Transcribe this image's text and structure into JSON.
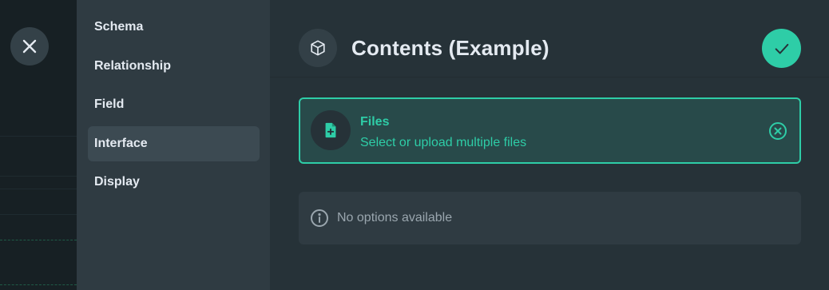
{
  "drawer": {
    "close_icon": "close-icon"
  },
  "sidebar": {
    "items": [
      {
        "label": "Schema",
        "active": false
      },
      {
        "label": "Relationship",
        "active": false
      },
      {
        "label": "Field",
        "active": false
      },
      {
        "label": "Interface",
        "active": true
      },
      {
        "label": "Display",
        "active": false
      }
    ]
  },
  "header": {
    "icon": "cube-icon",
    "title": "Contents (Example)",
    "save_icon": "check-icon"
  },
  "interface_card": {
    "icon": "file-upload-icon",
    "title": "Files",
    "subtitle": "Select or upload multiple files",
    "clear_icon": "close-circle-icon"
  },
  "notice": {
    "icon": "info-icon",
    "text": "No options available"
  },
  "colors": {
    "accent": "#2ECDA7",
    "background": "#263238",
    "sidebar": "#2F3B42",
    "backdrop": "#172024"
  }
}
